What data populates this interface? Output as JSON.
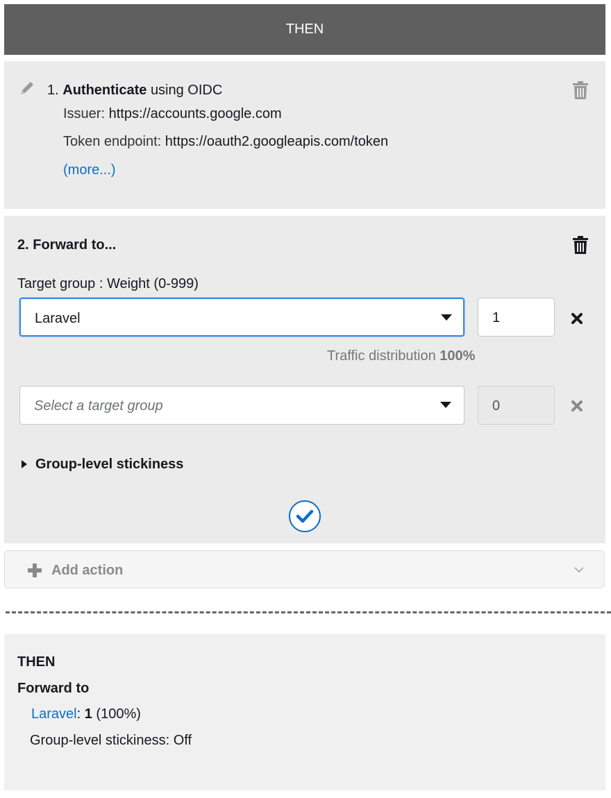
{
  "header": {
    "title": "THEN"
  },
  "action1": {
    "number": "1.",
    "verb": "Authenticate",
    "method": "using OIDC",
    "issuer_label": "Issuer:",
    "issuer_value": "https://accounts.google.com",
    "token_label": "Token endpoint:",
    "token_value": "https://oauth2.googleapis.com/token",
    "more_link": "(more...)"
  },
  "action2": {
    "title": "2. Forward to...",
    "column_label": "Target group : Weight (0-999)",
    "rows": [
      {
        "group": "Laravel",
        "weight": "1"
      },
      {
        "placeholder": "Select a target group",
        "weight": "0"
      }
    ],
    "traffic_label": "Traffic distribution",
    "traffic_value": "100%",
    "stickiness_label": "Group-level stickiness"
  },
  "add_action": {
    "label": "Add action"
  },
  "summary": {
    "then_label": "THEN",
    "forward_label": "Forward to",
    "target_name": "Laravel",
    "target_sep": ":",
    "target_weight": "1",
    "target_pct": "(100%)",
    "stickiness_text": "Group-level stickiness: Off"
  },
  "colors": {
    "header_bg": "#5f5f5f",
    "link": "#0d6fc8",
    "focus_border": "#3d89e0",
    "panel_bg": "#ebebeb"
  },
  "icons": [
    "pencil-icon",
    "trash-icon",
    "caret-down-icon",
    "close-icon",
    "check-circle-icon",
    "plus-icon",
    "chevron-down-icon",
    "expand-triangle-icon"
  ]
}
